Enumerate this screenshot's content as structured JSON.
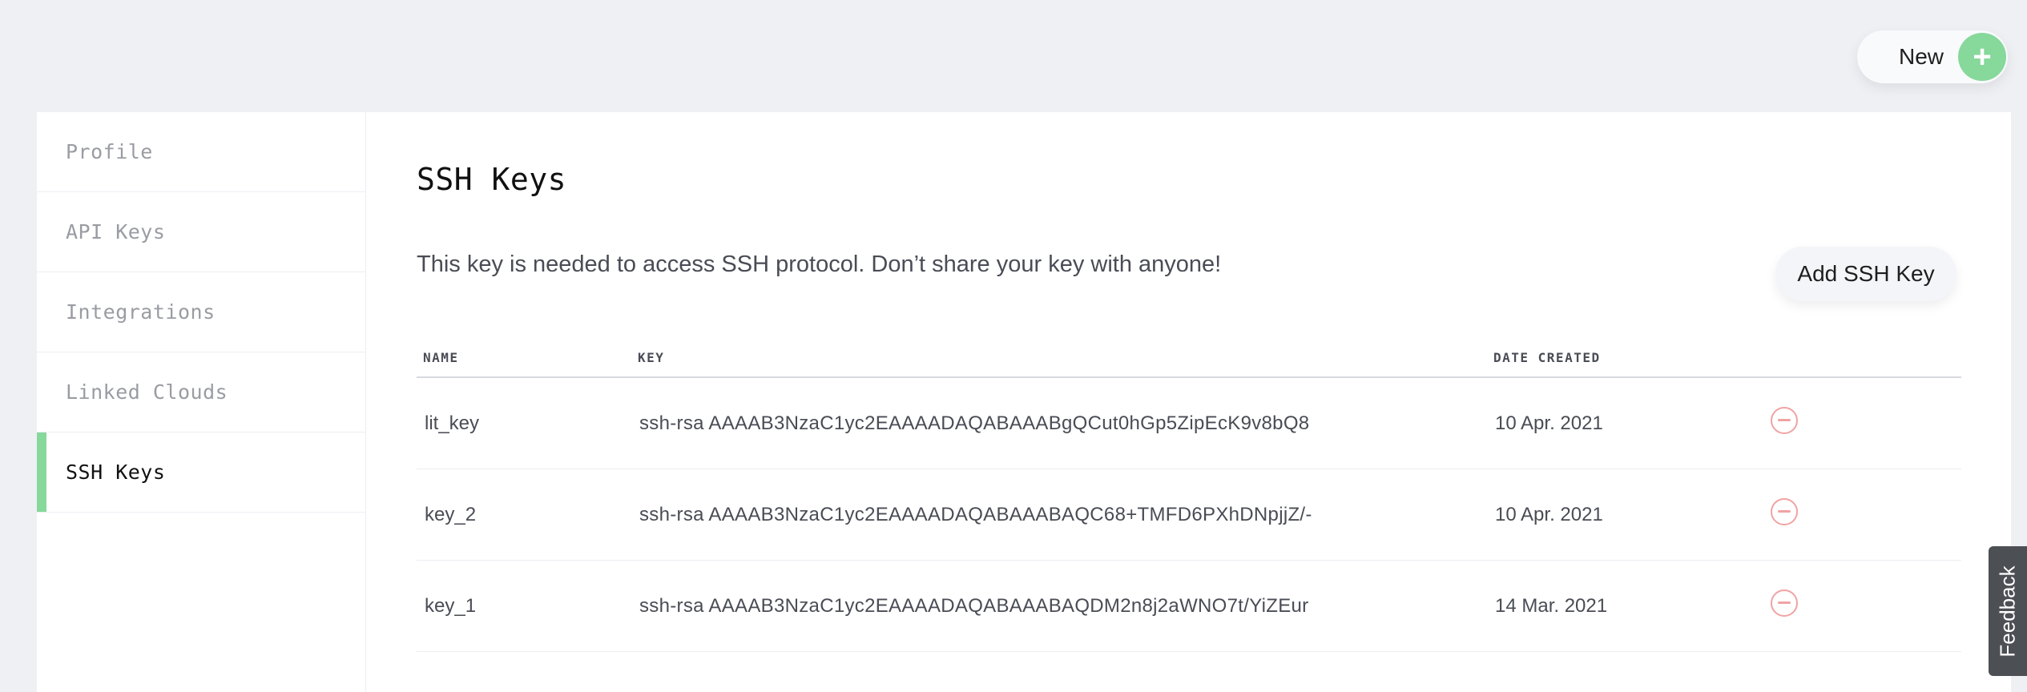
{
  "header": {
    "new_label": "New",
    "new_icon": "plus-icon"
  },
  "sidebar": {
    "items": [
      {
        "label": "Profile",
        "active": false
      },
      {
        "label": "API Keys",
        "active": false
      },
      {
        "label": "Integrations",
        "active": false
      },
      {
        "label": "Linked Clouds",
        "active": false
      },
      {
        "label": "SSH Keys",
        "active": true
      }
    ],
    "active_color": "#86d89b"
  },
  "main": {
    "title": "SSH Keys",
    "description": "This key is needed to access SSH protocol. Don’t share your key with anyone!",
    "add_button_label": "Add SSH Key",
    "table": {
      "columns": [
        "NAME",
        "KEY",
        "DATE CREATED"
      ],
      "rows": [
        {
          "name": "lit_key",
          "key": "ssh-rsa AAAAB3NzaC1yc2EAAAADAQABAAABgQCut0hGp5ZipEcK9v8bQ8",
          "date": "10 Apr. 2021",
          "action_icon": "remove-icon"
        },
        {
          "name": "key_2",
          "key": "ssh-rsa AAAAB3NzaC1yc2EAAAADAQABAAABAQC68+TMFD6PXhDNpjjZ/-",
          "date": "10 Apr. 2021",
          "action_icon": "remove-icon"
        },
        {
          "name": "key_1",
          "key": "ssh-rsa AAAAB3NzaC1yc2EAAAADAQABAAABAQDM2n8j2aWNO7t/YiZEur",
          "date": "14 Mar. 2021",
          "action_icon": "remove-icon"
        }
      ]
    }
  },
  "feedback": {
    "label": "Feedback"
  },
  "colors": {
    "background": "#eff0f4",
    "accent_green": "#86d89b",
    "remove_red": "#f0a3a3"
  }
}
